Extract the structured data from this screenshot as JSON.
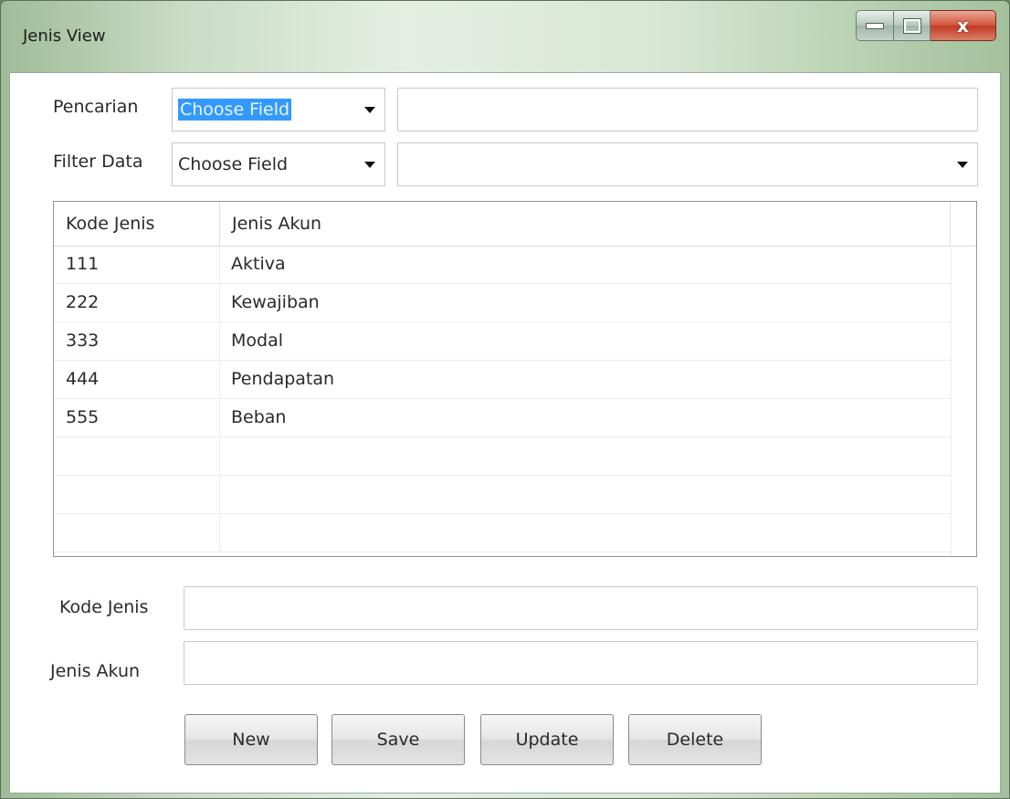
{
  "window": {
    "title": "Jenis View",
    "close_glyph": "x"
  },
  "search": {
    "label": "Pencarian",
    "field_select": "Choose Field",
    "query": ""
  },
  "filter": {
    "label": "Filter Data",
    "field_select": "Choose Field",
    "value_select": ""
  },
  "table": {
    "columns": [
      "Kode Jenis",
      "Jenis Akun"
    ],
    "rows": [
      {
        "kode": "111",
        "jenis": "Aktiva"
      },
      {
        "kode": "222",
        "jenis": "Kewajiban"
      },
      {
        "kode": "333",
        "jenis": "Modal"
      },
      {
        "kode": "444",
        "jenis": "Pendapatan"
      },
      {
        "kode": "555",
        "jenis": "Beban"
      }
    ]
  },
  "form": {
    "kode_label": "Kode Jenis",
    "kode_value": "",
    "jenis_label": "Jenis Akun",
    "jenis_value": ""
  },
  "buttons": {
    "new": "New",
    "save": "Save",
    "update": "Update",
    "delete": "Delete"
  }
}
